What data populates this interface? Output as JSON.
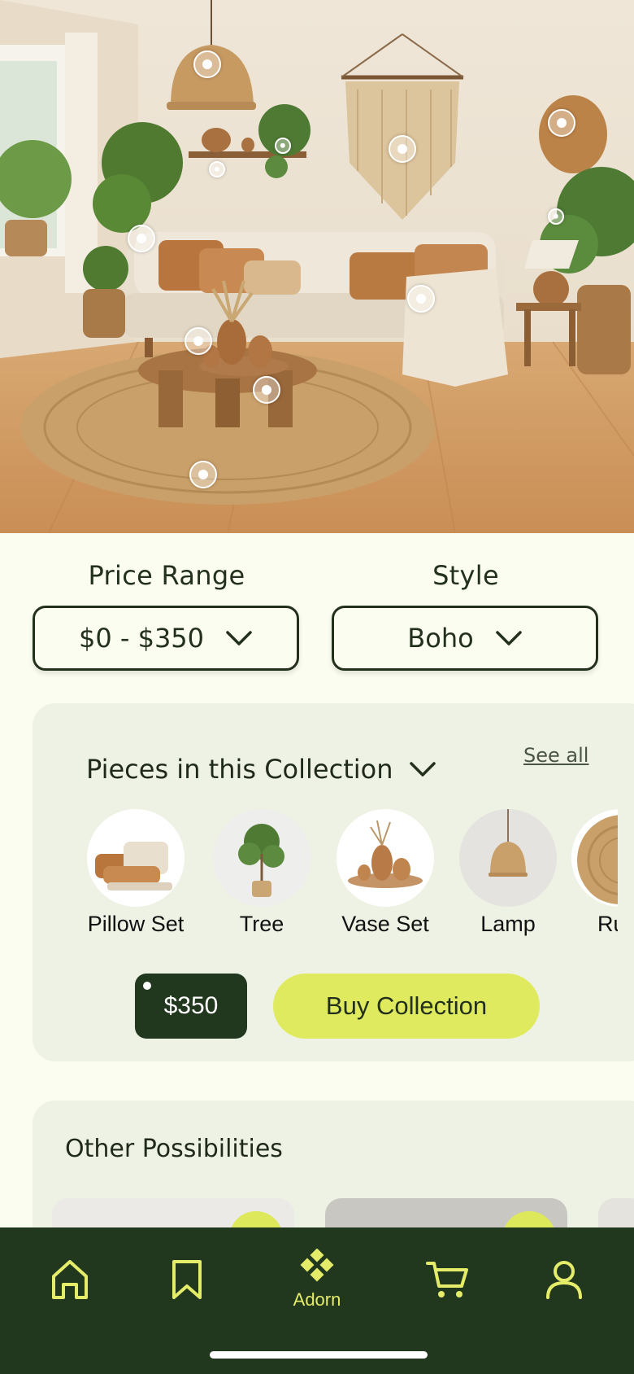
{
  "hero": {
    "hotspot_count": 13
  },
  "filters": {
    "price": {
      "label": "Price Range",
      "value": "$0 - $350"
    },
    "style": {
      "label": "Style",
      "value": "Boho"
    }
  },
  "collection": {
    "title": "Pieces in this Collection",
    "see_all": "See all",
    "pieces": [
      {
        "name": "Pillow Set"
      },
      {
        "name": "Tree"
      },
      {
        "name": "Vase Set"
      },
      {
        "name": "Lamp"
      },
      {
        "name": "Ru"
      }
    ],
    "price": "$350",
    "buy_label": "Buy Collection"
  },
  "other": {
    "title": "Other Possibilities"
  },
  "tabbar": {
    "active_label": "Adorn",
    "tabs": [
      "home-icon",
      "bookmark-icon",
      "adorn-icon",
      "cart-icon",
      "profile-icon"
    ],
    "accent": "#E4EC6A",
    "background": "#22381E"
  },
  "colors": {
    "background": "#FBFDF1",
    "card": "#EEF2E4",
    "buy_button": "#E0EA5F",
    "price_tag": "#22381E"
  }
}
